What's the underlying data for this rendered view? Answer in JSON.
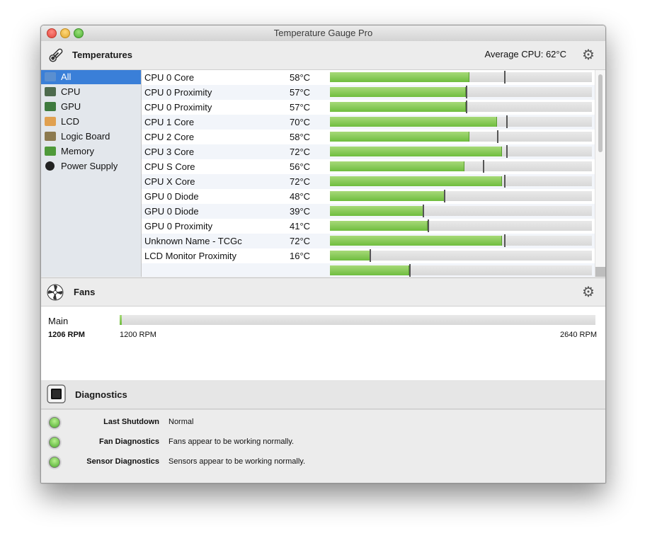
{
  "window": {
    "title": "Temperature Gauge Pro"
  },
  "temperatures": {
    "title": "Temperatures",
    "average_label": "Average CPU:",
    "average_value": "62°C",
    "sidebar": [
      {
        "label": "All",
        "icon": "display-icon",
        "selected": true
      },
      {
        "label": "CPU",
        "icon": "cpu-icon",
        "selected": false
      },
      {
        "label": "GPU",
        "icon": "gpu-icon",
        "selected": false
      },
      {
        "label": "LCD",
        "icon": "lcd-icon",
        "selected": false
      },
      {
        "label": "Logic Board",
        "icon": "logic-board-icon",
        "selected": false
      },
      {
        "label": "Memory",
        "icon": "memory-icon",
        "selected": false
      },
      {
        "label": "Power Supply",
        "icon": "power-icon",
        "selected": false
      }
    ],
    "rows": [
      {
        "name": "CPU 0 Core",
        "value": "58°C",
        "level": 0.53,
        "max": 0.665
      },
      {
        "name": "CPU 0 Proximity",
        "value": "57°C",
        "level": 0.515,
        "max": 0.52
      },
      {
        "name": "CPU 0 Proximity",
        "value": "57°C",
        "level": 0.515,
        "max": 0.52
      },
      {
        "name": "CPU 1 Core",
        "value": "70°C",
        "level": 0.635,
        "max": 0.672
      },
      {
        "name": "CPU 2 Core",
        "value": "58°C",
        "level": 0.53,
        "max": 0.637
      },
      {
        "name": "CPU 3 Core",
        "value": "72°C",
        "level": 0.655,
        "max": 0.672
      },
      {
        "name": "CPU S Core",
        "value": "56°C",
        "level": 0.51,
        "max": 0.585
      },
      {
        "name": "CPU X Core",
        "value": "72°C",
        "level": 0.655,
        "max": 0.665
      },
      {
        "name": "GPU 0 Diode",
        "value": "48°C",
        "level": 0.435,
        "max": 0.435
      },
      {
        "name": "GPU 0 Diode",
        "value": "39°C",
        "level": 0.355,
        "max": 0.355
      },
      {
        "name": "GPU 0 Proximity",
        "value": "41°C",
        "level": 0.37,
        "max": 0.372
      },
      {
        "name": "Unknown Name - TCGc",
        "value": "72°C",
        "level": 0.655,
        "max": 0.665
      },
      {
        "name": "LCD Monitor Proximity",
        "value": "16°C",
        "level": 0.15,
        "max": 0.152
      },
      {
        "name": "",
        "value": "",
        "level": 0.3,
        "max": 0.302
      }
    ]
  },
  "fans": {
    "title": "Fans",
    "items": [
      {
        "name": "Main",
        "rpm": "1206 RPM",
        "min": "1200 RPM",
        "max": "2640 RPM",
        "level": 0.004
      }
    ]
  },
  "diagnostics": {
    "title": "Diagnostics",
    "items": [
      {
        "label": "Last Shutdown",
        "value": "Normal"
      },
      {
        "label": "Fan Diagnostics",
        "value": "Fans appear to be working normally."
      },
      {
        "label": "Sensor Diagnostics",
        "value": "Sensors appear to be working normally."
      }
    ]
  },
  "colors": {
    "selection": "#3a7fd8",
    "bar_fill": "#6fbd3f",
    "led_ok": "#4aa82b"
  }
}
